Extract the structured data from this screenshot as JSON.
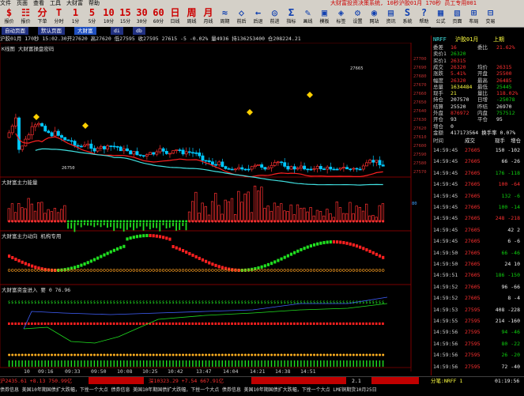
{
  "menu": [
    "文件",
    "页面",
    "查看",
    "工具",
    "大财富",
    "帮助"
  ],
  "app_title": "大财富投资决策系统, 10秒沪胶01月 170秒 员工专用001",
  "toolbar": [
    {
      "glyph": "$",
      "label": "报价"
    },
    {
      "glyph": "☷",
      "label": "报价"
    },
    {
      "glyph": "分",
      "label": "下单"
    },
    {
      "glyph": "T",
      "label": "分时"
    },
    {
      "glyph": "1",
      "label": "1分"
    },
    {
      "glyph": "5",
      "label": "5分"
    },
    {
      "glyph": "10",
      "label": "10分"
    },
    {
      "glyph": "15",
      "label": "15分"
    },
    {
      "glyph": "30",
      "label": "30分"
    },
    {
      "glyph": "60",
      "label": "60分"
    },
    {
      "glyph": "日",
      "label": "日线"
    },
    {
      "glyph": "周",
      "label": "周线"
    },
    {
      "glyph": "月",
      "label": "月线"
    },
    {
      "glyph": "≈",
      "label": "周期"
    },
    {
      "glyph": "◇",
      "label": "前后"
    },
    {
      "glyph": "←",
      "label": "后退"
    },
    {
      "glyph": "◎",
      "label": "前进"
    },
    {
      "glyph": "Σ",
      "label": "指标"
    },
    {
      "glyph": "✎",
      "label": "画线"
    },
    {
      "glyph": "▣",
      "label": "模板"
    },
    {
      "glyph": "◈",
      "label": "标签"
    },
    {
      "glyph": "⚙",
      "label": "设置"
    },
    {
      "glyph": "◉",
      "label": "网站"
    },
    {
      "glyph": "▤",
      "label": "资讯"
    },
    {
      "glyph": "S",
      "label": "系统"
    },
    {
      "glyph": "?",
      "label": "帮助"
    },
    {
      "glyph": "▦",
      "label": "公式"
    },
    {
      "glyph": "▧",
      "label": "页面"
    },
    {
      "glyph": "⊞",
      "label": "布局"
    },
    {
      "glyph": "⊟",
      "label": "交易"
    }
  ],
  "tabs": [
    "自动页面",
    "默认页面",
    "大财富",
    "di",
    "db"
  ],
  "info_line": "沪胶01月 170秒  15:02.30开27620 高27620 低27595 收27595 27615   -5  -0.02% 量4936 持136253400 仓208224.21",
  "panels": {
    "kline": "K线图  大财富操盘密码",
    "p1": "大财富主力能量",
    "p2": "大财富主力动向  机构专用",
    "p3": "大财富资金进入  要 0  76.96"
  },
  "price_labels": [
    "27700",
    "27690",
    "27680",
    "27670",
    "27660",
    "27650",
    "27640",
    "27630",
    "27620",
    "27610",
    "27600",
    "27590",
    "27580",
    "27570"
  ],
  "kline_annot": {
    "high": "27665",
    "low": "26750"
  },
  "p1_label": "80",
  "time_labels": [
    "10",
    "09:16",
    "09:33",
    "09:50",
    "10:08",
    "10:25",
    "10:42",
    "13:47",
    "14:04",
    "14:21",
    "14:38",
    "14:51"
  ],
  "quote": {
    "header": [
      "NRFF",
      "沪胶01月",
      "上期"
    ],
    "rows": [
      {
        "k": "委差",
        "v": "16",
        "c": "red",
        "k2": "委比",
        "v2": "21.62%",
        "c2": "red"
      },
      {
        "k": "卖价1",
        "v": "26320",
        "c": "grnt",
        "k2": "",
        "v2": "",
        "c2": ""
      },
      {
        "k": "买价1",
        "v": "26315",
        "c": "red",
        "k2": "",
        "v2": "",
        "c2": ""
      },
      {
        "k": "成交",
        "v": "26320",
        "c": "red",
        "k2": "均价",
        "v2": "26315",
        "c2": "red"
      },
      {
        "k": "涨跌",
        "v": "5.41%",
        "c": "red",
        "k2": "开盘",
        "v2": "25500",
        "c2": "red"
      },
      {
        "k": "幅度",
        "v": "26320",
        "c": "red",
        "k2": "最高",
        "v2": "26485",
        "c2": "red"
      },
      {
        "k": "总量",
        "v": "1634484",
        "c": "yel",
        "k2": "最低",
        "v2": "25445",
        "c2": "grnt"
      },
      {
        "k": "现手",
        "v": "21",
        "c": "yel",
        "k2": "量比",
        "v2": "118.02%",
        "c2": "red"
      },
      {
        "k": "持仓",
        "v": "207570",
        "c": "wht",
        "k2": "日增",
        "v2": "-25078",
        "c2": "grnt"
      },
      {
        "k": "结算",
        "v": "25520",
        "c": "wht",
        "k2": "昨结",
        "v2": "26970",
        "c2": "wht"
      },
      {
        "k": "外盘",
        "v": "876972",
        "c": "red",
        "k2": "内盘",
        "v2": "757512",
        "c2": "grnt"
      },
      {
        "k": "开仓",
        "v": "93",
        "c": "wht",
        "k2": "平仓",
        "v2": "95",
        "c2": "wht"
      },
      {
        "k": "增仓",
        "v": "0",
        "c": "wht",
        "k2": "",
        "v2": "",
        "c2": ""
      },
      {
        "k": "金额",
        "v": "417173564 换手率 0.07%",
        "c": "wht",
        "k2": "",
        "v2": "",
        "c2": ""
      }
    ]
  },
  "trades_header": [
    "时间",
    "成交",
    "现手",
    "增仓"
  ],
  "trades": [
    {
      "t": "14:59:45",
      "p": "27605",
      "q": "150 -102",
      "qc": "wht"
    },
    {
      "t": "14:59:45",
      "p": "27605",
      "q": "66 -26",
      "qc": "wht"
    },
    {
      "t": "14:59:45",
      "p": "27605",
      "q": "176 -118",
      "qc": "grnt"
    },
    {
      "t": "14:59:45",
      "p": "27605",
      "q": "100 -64",
      "qc": "red"
    },
    {
      "t": "14:59:45",
      "p": "27605",
      "q": "132 -6",
      "qc": "grnt"
    },
    {
      "t": "14:59:45",
      "p": "27605",
      "q": "100 -14",
      "qc": "grnt"
    },
    {
      "t": "14:59:45",
      "p": "27605",
      "q": "248 -218",
      "qc": "red"
    },
    {
      "t": "14:59:45",
      "p": "27605",
      "q": "42 2",
      "qc": "wht"
    },
    {
      "t": "14:59:45",
      "p": "27605",
      "q": "6 -6",
      "qc": "wht"
    },
    {
      "t": "14:59:50",
      "p": "27605",
      "q": "66 -46",
      "qc": "grnt"
    },
    {
      "t": "14:59:50",
      "p": "27605",
      "q": "24 10",
      "qc": "wht"
    },
    {
      "t": "14:59:51",
      "p": "27605",
      "q": "186 -150",
      "qc": "grnt"
    },
    {
      "t": "14:59:52",
      "p": "27605",
      "q": "96 -66",
      "qc": "wht"
    },
    {
      "t": "14:59:52",
      "p": "27605",
      "q": "8 -4",
      "qc": "wht"
    },
    {
      "t": "14:59:53",
      "p": "27595",
      "q": "408 -228",
      "qc": "wht"
    },
    {
      "t": "14:59:55",
      "p": "27595",
      "q": "214 -160",
      "qc": "wht"
    },
    {
      "t": "14:59:56",
      "p": "27595",
      "q": "94 -46",
      "qc": "grnt"
    },
    {
      "t": "14:59:56",
      "p": "27595",
      "q": "80 -22",
      "qc": "grnt"
    },
    {
      "t": "14:59:56",
      "p": "27595",
      "q": "26 -20",
      "qc": "grnt"
    },
    {
      "t": "14:59:56",
      "p": "27595",
      "q": "72 -40",
      "qc": "wht"
    }
  ],
  "status": {
    "sh": "沪2435.61 +8.13 750.99亿",
    "sz": "深10323.29 +7.54 667.91亿",
    "num": "2.1",
    "right": "分笔:NRFF 1",
    "time": "01:19:56"
  },
  "ticker": "债券信息  美国10年期国债扩大跌幅，下挫一个大点      债券信息  美国10年期国债扩大跌幅，下挫一个大点      债券信息  美国10年期国债扩大跌幅，下挫一个大点    LME铜期货10月25日",
  "colors": {
    "up": "#ff3030",
    "down": "#00c0ff",
    "ma1": "#ff2020",
    "ma2": "#40e0e0",
    "grid": "#800000",
    "accent": "#d4d0c8"
  }
}
